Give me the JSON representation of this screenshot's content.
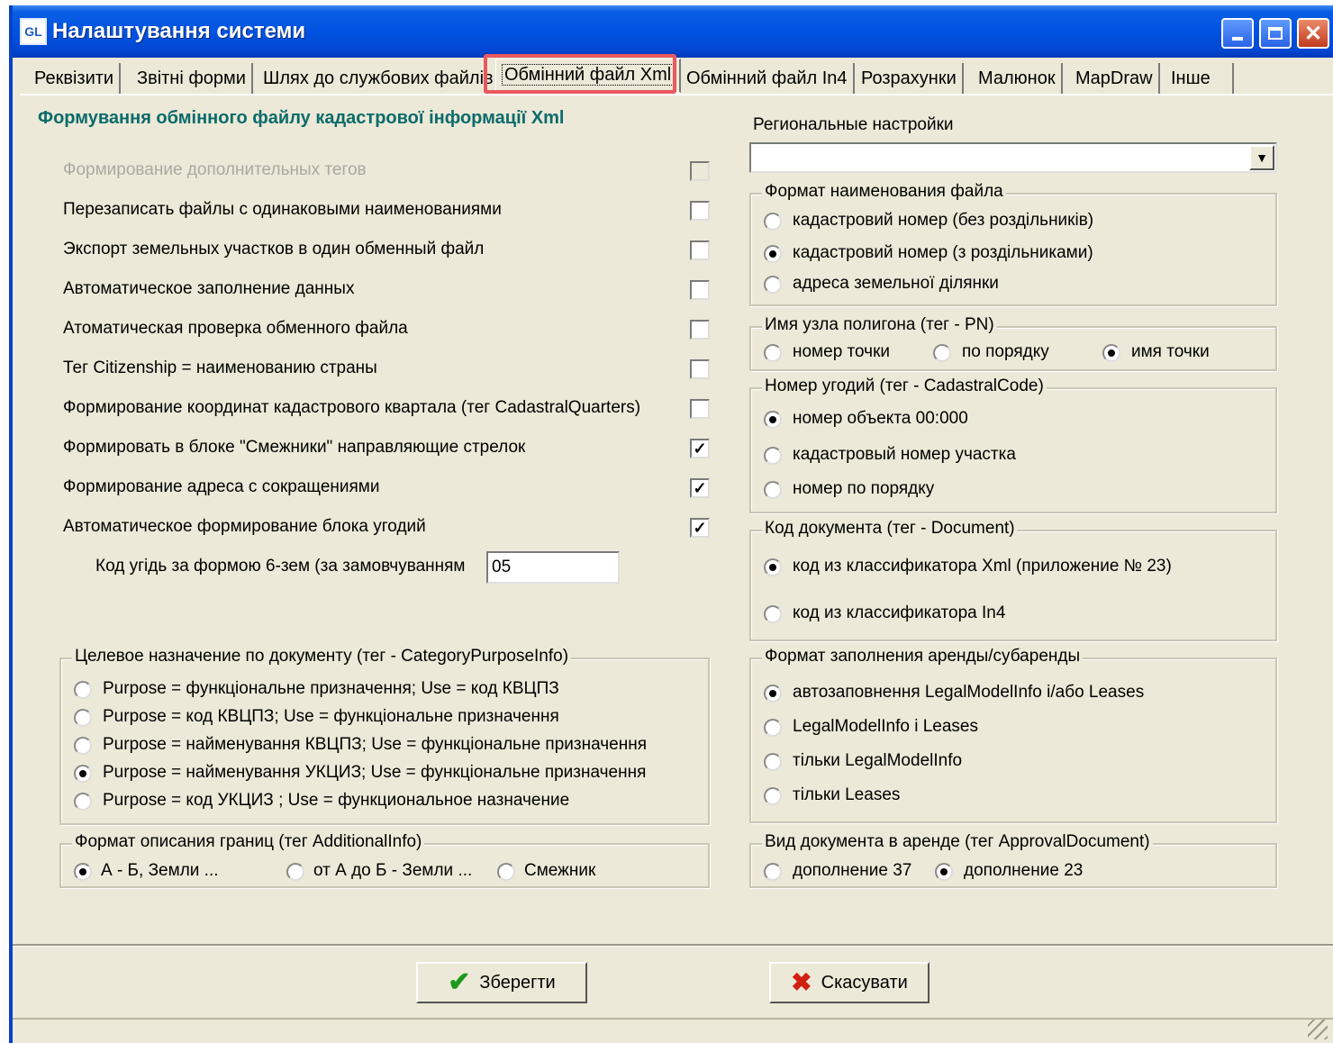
{
  "window": {
    "title": "Налаштування системи",
    "icon": "app-icon"
  },
  "tabs": [
    {
      "label": "Реквізити"
    },
    {
      "label": "Звітні форми"
    },
    {
      "label": "Шлях до службових файлів"
    },
    {
      "label": "Обмінний файл Xml"
    },
    {
      "label": "Обмінний файл In4"
    },
    {
      "label": "Розрахунки"
    },
    {
      "label": "Малюнок"
    },
    {
      "label": "MapDraw"
    },
    {
      "label": "Інше"
    }
  ],
  "active_tab": "Обмінний файл Xml",
  "left": {
    "heading": "Формування обмінного файлу кадастрової інформації Xml",
    "options": [
      {
        "label": "Формирование дополнительных тегов",
        "checked": false,
        "disabled": true
      },
      {
        "label": "Перезаписать файлы с одинаковыми наименованиями",
        "checked": false
      },
      {
        "label": "Экспорт земельных участков в один обменный файл",
        "checked": false
      },
      {
        "label": "Автоматическое заполнение данных",
        "checked": false
      },
      {
        "label": "Атоматическая проверка обменного файла",
        "checked": false
      },
      {
        "label": "Тег Citizenship = наименованию страны",
        "checked": false
      },
      {
        "label": "Формирование координат кадастрового квартала (тег CadastralQuarters)",
        "checked": false
      },
      {
        "label": "Формировать в блоке \"Смежники\" направляющие стрелок",
        "checked": true
      },
      {
        "label": "Формирование адреса с сокращениями",
        "checked": true
      },
      {
        "label": "Автоматическое формирование блока угодий",
        "checked": true
      }
    ],
    "code_label": "Код угідь за формою 6-зем (за замовчуванням",
    "code_value": "05",
    "purpose_group": {
      "title": "Целевое назначение по документу (тег - CategoryPurposeInfo)",
      "items": [
        {
          "label": "Purpose = функціональне призначення; Use = код КВЦПЗ",
          "selected": false
        },
        {
          "label": "Purpose = код КВЦПЗ; Use = функціональне призначення",
          "selected": false
        },
        {
          "label": "Purpose = найменування КВЦПЗ; Use = функціональне призначення",
          "selected": false
        },
        {
          "label": "Purpose = найменування УКЦИЗ; Use = функціональне призначення",
          "selected": true
        },
        {
          "label": "Purpose = код УКЦИЗ ; Use = функциональное назначение",
          "selected": false
        }
      ]
    },
    "border_group": {
      "title": "Формат описания границ (тег AdditionalInfo)",
      "items": [
        {
          "label": "А - Б, Земли ...",
          "selected": true
        },
        {
          "label": "от А до Б - Земли ...",
          "selected": false
        },
        {
          "label": "Смежник",
          "selected": false
        }
      ]
    }
  },
  "right": {
    "regional_label": "Региональные настройки",
    "regional_value": "",
    "filename_group": {
      "title": "Формат наименования файла",
      "items": [
        {
          "label": "кадастровий номер (без роздільників)",
          "selected": false
        },
        {
          "label": "кадастровий номер (з роздільниками)",
          "selected": true
        },
        {
          "label": "адреса земельної ділянки",
          "selected": false
        }
      ]
    },
    "node_group": {
      "title": "Имя узла полигона (тег - PN)",
      "items": [
        {
          "label": "номер точки",
          "selected": false
        },
        {
          "label": "по порядку",
          "selected": false
        },
        {
          "label": "имя точки",
          "selected": true
        }
      ]
    },
    "land_group": {
      "title": "Номер угодий (тег - CadastralCode)",
      "items": [
        {
          "label": "номер объекта 00:000",
          "selected": true
        },
        {
          "label": "кадастровый номер участка",
          "selected": false
        },
        {
          "label": "номер по порядку",
          "selected": false
        }
      ]
    },
    "doc_group": {
      "title": "Код документа (тег - Document)",
      "items": [
        {
          "label": "код из классификатора Xml (приложение № 23)",
          "selected": true
        },
        {
          "label": "код из классификатора In4",
          "selected": false
        }
      ]
    },
    "lease_group": {
      "title": "Формат заполнения аренды/субаренды",
      "items": [
        {
          "label": "автозаповнення LegalModelInfo i/або Leases",
          "selected": true
        },
        {
          "label": "LegalModelInfo i Leases",
          "selected": false
        },
        {
          "label": "тільки LegalModelInfo",
          "selected": false
        },
        {
          "label": "тільки Leases",
          "selected": false
        }
      ]
    },
    "approval_group": {
      "title": "Вид документа в аренде (тег ApprovalDocument)",
      "items": [
        {
          "label": "дополнение 37",
          "selected": false
        },
        {
          "label": "дополнение 23",
          "selected": true
        }
      ]
    }
  },
  "buttons": {
    "save": "Зберегти",
    "cancel": "Скасувати"
  },
  "colors": {
    "heading": "#0b6b6b",
    "titlebar": "#0053e1",
    "save_icon": "#1a9a1a",
    "cancel_icon": "#d02010"
  }
}
